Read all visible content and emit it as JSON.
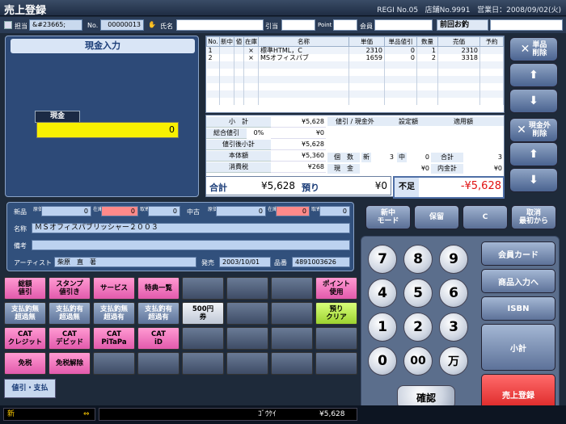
{
  "title": "売上登録",
  "regi": "REGI No.05",
  "store": "店舗No.9991",
  "bizdate": "営業日：2008/09/02(火)",
  "header": {
    "tanto_label": "担当",
    "tanto_value": "&#23665;",
    "no_label": "No.",
    "no_value": "00000013",
    "name_label": "氏名",
    "hikiate_label": "引当",
    "point_label": "Point",
    "kaiin_label": "会員",
    "prev_label": "前回お釣"
  },
  "cash": {
    "title": "現金入力",
    "money_label": "現金",
    "money_value": "0"
  },
  "grid": {
    "headers": [
      "No.",
      "新中",
      "値",
      "在庫",
      "名称",
      "単価",
      "単品値引",
      "数量",
      "売価",
      "予約"
    ],
    "rows": [
      [
        "1",
        "",
        "",
        "×",
        "標準HTML，C",
        "2310",
        "0",
        "1",
        "2310",
        ""
      ],
      [
        "2",
        "",
        "",
        "×",
        "MSオフィスパブ",
        "1659",
        "0",
        "2",
        "3318",
        ""
      ]
    ]
  },
  "subtotal": {
    "shokei_l": "小　計",
    "shokei_v": "¥5,628",
    "sogo_l": "総合値引",
    "sogo_pct": "0%",
    "sogo_v": "¥0",
    "nebiki_l": "値引後小計",
    "nebiki_v": "¥5,628",
    "hontai_l": "本体額",
    "hontai_v": "¥5,360",
    "zei_l": "消費税",
    "zei_v": "¥268",
    "h1": "値引 / 現金外",
    "h2": "設定額",
    "h3": "適用額",
    "kosu_l": "個　数",
    "shin_l": "新",
    "shin_v": "3",
    "chu_l": "中",
    "chu_v": "0",
    "gokei_l": "合計",
    "gokei_v": "3",
    "genkin_l": "現　金",
    "genkin_v": "¥0",
    "uchi_l": "内金計",
    "uchi_v": "¥0",
    "total_l": "合計",
    "total_v": "¥5,628",
    "azukari_l": "預り",
    "azukari_v": "¥0",
    "fusoku_l": "不足",
    "fusoku_v": "-¥5,628"
  },
  "side": {
    "b1": "単品\n削除",
    "b2": "",
    "b3": "",
    "b4": "現金外\n削除",
    "b5": "",
    "b6": ""
  },
  "info": {
    "shinpin": "新品",
    "genka": "原価",
    "zaiko": "在庫",
    "sokosu": "取寄",
    "shinpin_v1": "0",
    "shinpin_v2": "0",
    "shinpin_v3": "0",
    "chuko": "中古",
    "chuko_v1": "0",
    "chuko_v2": "0",
    "chuko_v3": "0",
    "name_l": "名称",
    "name_v": "ＭＳオフィスパブリッシャー２００３",
    "biko_l": "備考",
    "biko_v": "",
    "artist_l": "アーティスト",
    "artist_v": "柴原　直　著",
    "hatsubai_l": "発売",
    "hatsubai_v": "2003/10/01",
    "hinban_l": "品番",
    "hinban_v": "4891003626"
  },
  "mode": {
    "m1": "新中\nモード",
    "m2": "保留",
    "m3": "C",
    "m4": "取消\n最初から"
  },
  "pads": [
    [
      "総額\n値引",
      "スタンプ\n値引き",
      "サービス",
      "特典一覧",
      "",
      "",
      "",
      "ポイント\n使用"
    ],
    [
      "支払釣無\n超過無",
      "支払釣有\n超過無",
      "支払釣無\n超過有",
      "支払釣有\n超過有",
      "500円\n券",
      "",
      "",
      "預り\nクリア"
    ],
    [
      "CAT\nクレジット",
      "CAT\nデビッド",
      "CAT\nPiTaPa",
      "CAT\niD",
      "",
      "",
      "",
      ""
    ],
    [
      "免税",
      "免税解除",
      "",
      "",
      "",
      "",
      "",
      ""
    ]
  ],
  "tab": "値引・支払",
  "keys": {
    "k7": "7",
    "k8": "8",
    "k9": "9",
    "k4": "4",
    "k5": "5",
    "k6": "6",
    "k1": "1",
    "k2": "2",
    "k3": "3",
    "k0": "0",
    "k00": "00",
    "kman": "万",
    "kakunin": "確認"
  },
  "fkeys": {
    "f1": "会員カード",
    "f2": "商品入力へ",
    "f3": "ISBN",
    "f4": "小計",
    "f5": "売上登録"
  },
  "status": {
    "mode": "新",
    "arrow": "⇔",
    "gokei_l": "ｺﾞｳｹｲ",
    "gokei_v": "¥5,628"
  }
}
